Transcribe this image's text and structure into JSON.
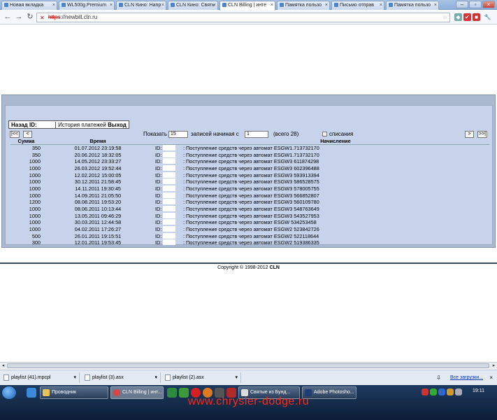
{
  "browser": {
    "tabs": [
      {
        "label": "Новая вкладка"
      },
      {
        "label": "WL500g.Premium"
      },
      {
        "label": "CLN Кино: Напр"
      },
      {
        "label": "CLN Кино: Свять"
      },
      {
        "label": "CLN Billing | инте"
      },
      {
        "label": "Памятка пользо"
      },
      {
        "label": "Письмо отправ"
      },
      {
        "label": "Памятка пользо"
      }
    ],
    "address": {
      "scheme": "https",
      "rest": "://newbill.cln.ru"
    }
  },
  "page": {
    "nav": {
      "back": "Назад",
      "id_label": "ID:",
      "history": "История платежей",
      "exit": "Выход"
    },
    "pager": {
      "first": "|<<",
      "prev": "<",
      "show_label": "Показать",
      "show_value": "15",
      "records_label": "записей  начиная с",
      "start_value": "1",
      "total_text": "(всего 28)",
      "writeoffs_label": "списания",
      "next": ">",
      "last": ">>|"
    },
    "table": {
      "headers": [
        "Сумма",
        "Время",
        "Начисление"
      ],
      "rows": [
        {
          "sum": "350",
          "time": "01.07.2012 23:19:58",
          "id": "ID:",
          "desc": ": Поступление средств через автомат ESGW1.713732170"
        },
        {
          "sum": "350",
          "time": "20.06.2012 18:32:05",
          "id": "ID:",
          "desc": ": Поступление средств через автомат ESGW1.713732170"
        },
        {
          "sum": "1000",
          "time": "14.05.2012 23:33:27",
          "id": "ID:",
          "desc": ": Поступление средств через автомат ESGW3 611874298"
        },
        {
          "sum": "1000",
          "time": "26.03.2012 19:52:44",
          "id": "ID:",
          "desc": ": Поступление средств через автомат ESGW3 602396488"
        },
        {
          "sum": "1000",
          "time": "12.02.2012 15:00:05",
          "id": "ID:",
          "desc": ": Поступление средств через автомат ESGW3 593913394"
        },
        {
          "sum": "1000",
          "time": "30.12.2011 21:58:45",
          "id": "ID:",
          "desc": ": Поступление средств через автомат ESGW3 586528575"
        },
        {
          "sum": "1000",
          "time": "14.11.2011 19:30:45",
          "id": "ID:",
          "desc": ": Поступление средств через автомат ESGW3 578005755"
        },
        {
          "sum": "1000",
          "time": "14.09.2011 21:05:50",
          "id": "ID:",
          "desc": ": Поступление средств через автомат ESGW3 566852807"
        },
        {
          "sum": "1200",
          "time": "08.08.2011 19:53:20",
          "id": "ID:",
          "desc": ": Поступление средств через автомат ESGW3 560109780"
        },
        {
          "sum": "1000",
          "time": "08.06.2011 10:13:44",
          "id": "ID:",
          "desc": ": Поступление средств через автомат ESGW3 548763649"
        },
        {
          "sum": "1000",
          "time": "13.05.2011 09:46:29",
          "id": "ID:",
          "desc": ": Поступление средств через автомат ESGW3 543527953"
        },
        {
          "sum": "1000",
          "time": "30.03.2011 12:44:58",
          "id": "ID:",
          "desc": ": Поступление средств через автомат ESGW 534253458"
        },
        {
          "sum": "1000",
          "time": "04.02.2011 17:26:27",
          "id": "ID:",
          "desc": ": Поступление средств через автомат ESGW2 523842726"
        },
        {
          "sum": "500",
          "time": "26.01.2011 19:15:51",
          "id": "ID:",
          "desc": ": Поступление средств через автомат ESGW2 522118644"
        },
        {
          "sum": "300",
          "time": "12.01.2011 19:53:45",
          "id": "ID:",
          "desc": ": Поступление средств через автомат ESGW2 519386335"
        }
      ]
    },
    "copyright_prefix": "Copyright © 1998-2012 ",
    "copyright_brand": "CLN"
  },
  "downloads": {
    "items": [
      {
        "label": "playlist (41).mpcpl"
      },
      {
        "label": "playlist (3).asx"
      },
      {
        "label": "playlist (2).asx"
      }
    ],
    "show_all": "Все загрузки..."
  },
  "taskbar": {
    "tasks": [
      {
        "label": "Проводник"
      },
      {
        "label": "CLN Billing | инт..."
      },
      {
        "label": "Святые из Бунд..."
      },
      {
        "label": "Adobe Photosho..."
      }
    ],
    "clock": "19:11"
  },
  "watermark": "www.chrysler-dodge.ru",
  "colors": {
    "accent": "#c6d3ea",
    "panel": "#aab9cf",
    "watermark": "#ff2a1a",
    "taskbar": "#1e3a5f"
  }
}
